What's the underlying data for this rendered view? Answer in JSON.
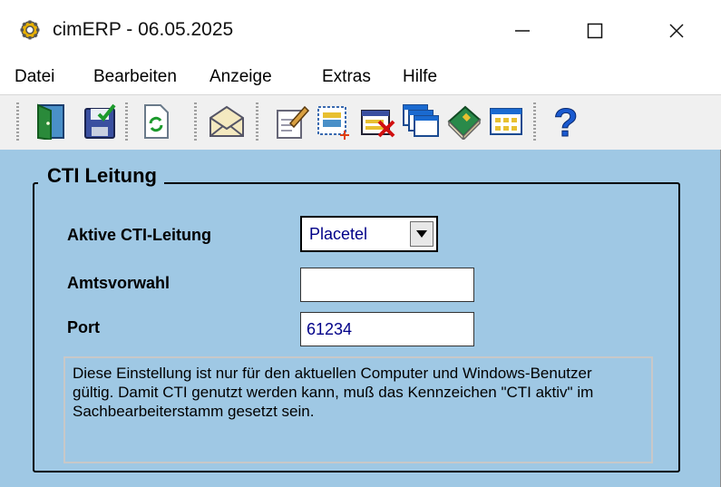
{
  "window": {
    "title": "cimERP - 06.05.2025"
  },
  "menu": {
    "items": [
      "Datei",
      "Bearbeiten",
      "Anzeige",
      "Extras",
      "Hilfe"
    ]
  },
  "toolbar": {
    "buttons": [
      "exit-door",
      "save-disk",
      "refresh",
      "mail-envelope",
      "edit-document",
      "new-record",
      "delete-record",
      "windows",
      "book",
      "table-grid",
      "help"
    ]
  },
  "group": {
    "title": "CTI Leitung",
    "fields": {
      "line_label": "Aktive CTI-Leitung",
      "line_value": "Placetel",
      "prefix_label": "Amtsvorwahl",
      "prefix_value": "",
      "port_label": "Port",
      "port_value": "61234"
    },
    "info": "Diese Einstellung ist nur für den aktuellen Computer und Windows-Benutzer gültig. Damit CTI genutzt werden kann, muß das Kennzeichen \"CTI aktiv\" im Sachbearbeiterstamm gesetzt sein."
  },
  "colors": {
    "content_bg": "#9fc8e4",
    "input_text": "#000088"
  }
}
